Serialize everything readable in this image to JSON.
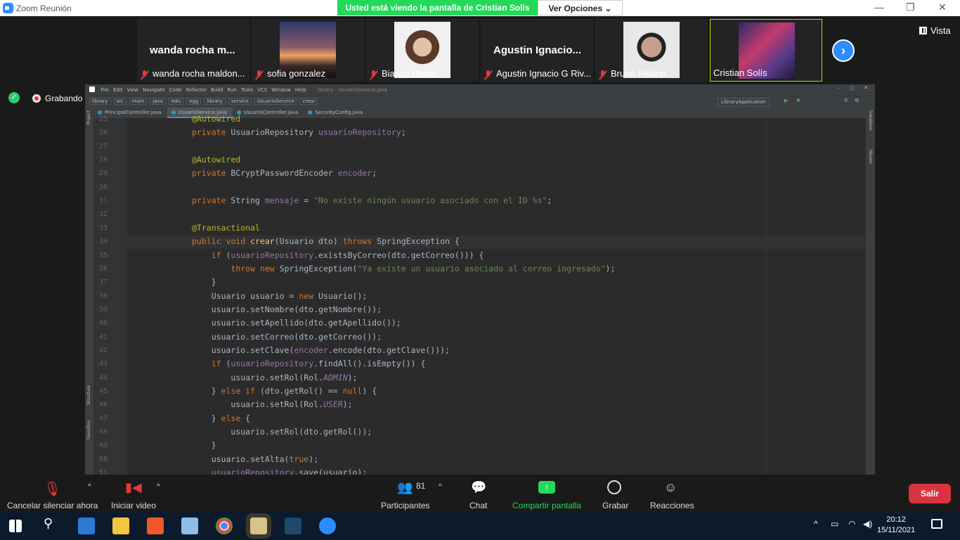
{
  "window": {
    "title": "Zoom Reunión"
  },
  "banner": {
    "text": "Usted está viendo la pantalla de Cristian Solís",
    "options_label": "Ver Opciones ⌄"
  },
  "view_label": "Vista",
  "recording_label": "Grabando",
  "participants": [
    {
      "big_name": "wanda rocha m...",
      "caption": "wanda rocha maldon..."
    },
    {
      "caption": "sofia gonzalez"
    },
    {
      "caption": "Bianca Dente"
    },
    {
      "big_name": "Agustin  Ignacio...",
      "caption": "Agustin Ignacio G Riv..."
    },
    {
      "caption": "Bruno Redzio"
    },
    {
      "caption": "Cristian Solís"
    }
  ],
  "ide": {
    "menu": [
      "File",
      "Edit",
      "View",
      "Navigate",
      "Code",
      "Refactor",
      "Build",
      "Run",
      "Tools",
      "VCS",
      "Window",
      "Help"
    ],
    "project_title": "library - UsuarioService.java",
    "breadcrumbs": [
      "library",
      "src",
      "main",
      "java",
      "edu",
      "egg",
      "library",
      "service",
      "UsuarioService",
      "crear"
    ],
    "run_config": "LibraryApplication",
    "tabs": [
      "PrincipalController.java",
      "UsuarioService.java",
      "UsuarioController.java",
      "SecurityConfig.java"
    ],
    "active_tab_index": 1,
    "side_left": [
      "Project",
      "Structure",
      "Favorites"
    ],
    "side_right": [
      "Database",
      "Maven"
    ]
  },
  "code_lines": [
    {
      "n": "25",
      "html": "<span class='an'>@Autowired</span>"
    },
    {
      "n": "26",
      "html": "<span class='kw'>private</span> UsuarioRepository <span class='fd'>usuarioRepository</span>;"
    },
    {
      "n": "27",
      "html": ""
    },
    {
      "n": "28",
      "html": "<span class='an'>@Autowired</span>"
    },
    {
      "n": "29",
      "html": "<span class='kw'>private</span> BCryptPasswordEncoder <span class='fd'>encoder</span>;"
    },
    {
      "n": "30",
      "html": ""
    },
    {
      "n": "31",
      "html": "<span class='kw'>private</span> String <span class='fd'>mensaje</span> = <span class='st'>\"No existe ningún usuario asociado con el ID %s\"</span>;"
    },
    {
      "n": "32",
      "html": ""
    },
    {
      "n": "33",
      "html": "<span class='an'>@Transactional</span>"
    },
    {
      "n": "34",
      "html": "<span class='kw'>public void</span> <span class='fn'>crear</span>(Usuario dto) <span class='kw'>throws</span> SpringException {"
    },
    {
      "n": "35",
      "html": "    <span class='kw'>if</span> (<span class='fd'>usuarioRepository</span>.existsByCorreo(dto.getCorreo())) {"
    },
    {
      "n": "36",
      "html": "        <span class='kw'>throw new</span> SpringException(<span class='st'>\"Ya existe un usuario asociado al correo ingresado\"</span>);"
    },
    {
      "n": "37",
      "html": "    }"
    },
    {
      "n": "38",
      "html": "    Usuario usuario = <span class='kw'>new</span> Usuario();"
    },
    {
      "n": "39",
      "html": "    usuario.setNombre(dto.getNombre());"
    },
    {
      "n": "40",
      "html": "    usuario.setApellido(dto.getApellido());"
    },
    {
      "n": "41",
      "html": "    usuario.setCorreo(dto.getCorreo());"
    },
    {
      "n": "42",
      "html": "    usuario.setClave(<span class='fd'>encoder</span>.encode(dto.getClave()));"
    },
    {
      "n": "43",
      "html": "    <span class='kw'>if</span> (<span class='fd'>usuarioRepository</span>.findAll().isEmpty()) {"
    },
    {
      "n": "44",
      "html": "        usuario.setRol(Rol.<span class='it'>ADMIN</span>);"
    },
    {
      "n": "45",
      "html": "    } <span class='kw'>else if</span> (dto.getRol() == <span class='kw'>null</span>) {"
    },
    {
      "n": "46",
      "html": "        usuario.setRol(Rol.<span class='it'>USER</span>);"
    },
    {
      "n": "47",
      "html": "    } <span class='kw'>else</span> {"
    },
    {
      "n": "48",
      "html": "        usuario.setRol(dto.getRol());"
    },
    {
      "n": "49",
      "html": "    }"
    },
    {
      "n": "50",
      "html": "    usuario.setAlta(<span class='kw'>true</span>);"
    },
    {
      "n": "51",
      "html": "    <span class='fd'>usuarioRepository</span>.save(usuario);"
    }
  ],
  "toolbar": {
    "mute": "Cancelar silenciar ahora",
    "video": "Iniciar video",
    "participants": "Participantes",
    "participants_count": "81",
    "chat": "Chat",
    "share": "Compartir pantalla",
    "record": "Grabar",
    "reactions": "Reacciones",
    "leave": "Salir"
  },
  "taskbar": {
    "time": "20:12",
    "date": "15/11/2021"
  }
}
